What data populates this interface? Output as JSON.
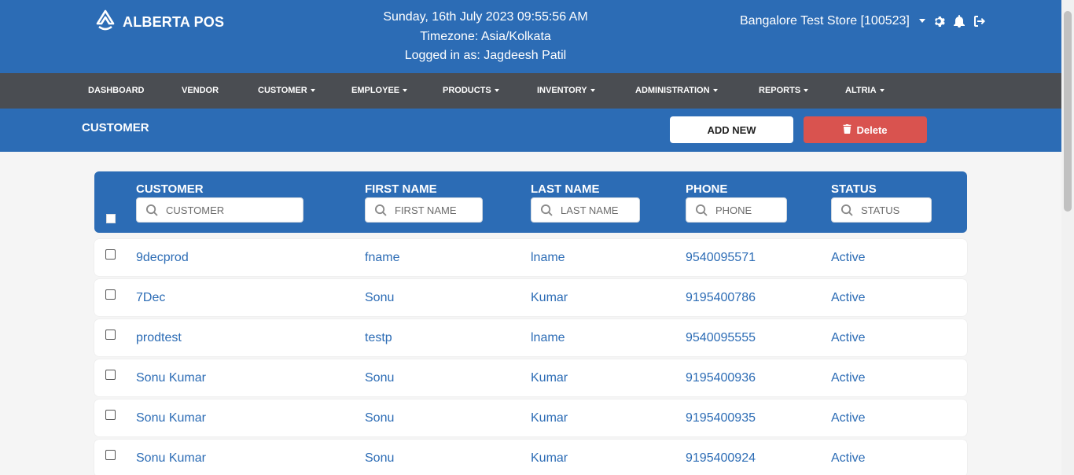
{
  "brand": {
    "name": "ALBERTA POS"
  },
  "header": {
    "datetime": "Sunday, 16th July 2023 09:55:56 AM",
    "timezone": "Timezone: Asia/Kolkata",
    "logged_in": "Logged in as: Jagdeesh Patil",
    "store": "Bangalore Test Store [100523]",
    "icons": [
      "gear-icon",
      "bell-icon",
      "logout-icon"
    ]
  },
  "nav": {
    "items": [
      {
        "label": "DASHBOARD",
        "dropdown": false
      },
      {
        "label": "VENDOR",
        "dropdown": false
      },
      {
        "label": "CUSTOMER",
        "dropdown": true
      },
      {
        "label": "EMPLOYEE",
        "dropdown": true
      },
      {
        "label": "PRODUCTS",
        "dropdown": true
      },
      {
        "label": "INVENTORY",
        "dropdown": true
      },
      {
        "label": "ADMINISTRATION",
        "dropdown": true
      },
      {
        "label": "REPORTS",
        "dropdown": true
      },
      {
        "label": "ALTRIA",
        "dropdown": true
      }
    ]
  },
  "page": {
    "title": "CUSTOMER",
    "add_label": "ADD NEW",
    "delete_label": "Delete"
  },
  "table": {
    "columns": [
      {
        "label": "CUSTOMER",
        "placeholder": "CUSTOMER"
      },
      {
        "label": "FIRST NAME",
        "placeholder": "FIRST NAME"
      },
      {
        "label": "LAST NAME",
        "placeholder": "LAST NAME"
      },
      {
        "label": "PHONE",
        "placeholder": "PHONE"
      },
      {
        "label": "STATUS",
        "placeholder": "STATUS"
      }
    ],
    "rows": [
      [
        "9decprod",
        "fname",
        "lname",
        "9540095571",
        "Active"
      ],
      [
        "7Dec",
        "Sonu",
        "Kumar",
        "9195400786",
        "Active"
      ],
      [
        "prodtest",
        "testp",
        "lname",
        "9540095555",
        "Active"
      ],
      [
        "Sonu Kumar",
        "Sonu",
        "Kumar",
        "9195400936",
        "Active"
      ],
      [
        "Sonu Kumar",
        "Sonu",
        "Kumar",
        "9195400935",
        "Active"
      ],
      [
        "Sonu Kumar",
        "Sonu",
        "Kumar",
        "9195400924",
        "Active"
      ]
    ]
  },
  "colors": {
    "primary": "#2c6cb5",
    "nav": "#4a4d52",
    "danger": "#d9534f"
  }
}
